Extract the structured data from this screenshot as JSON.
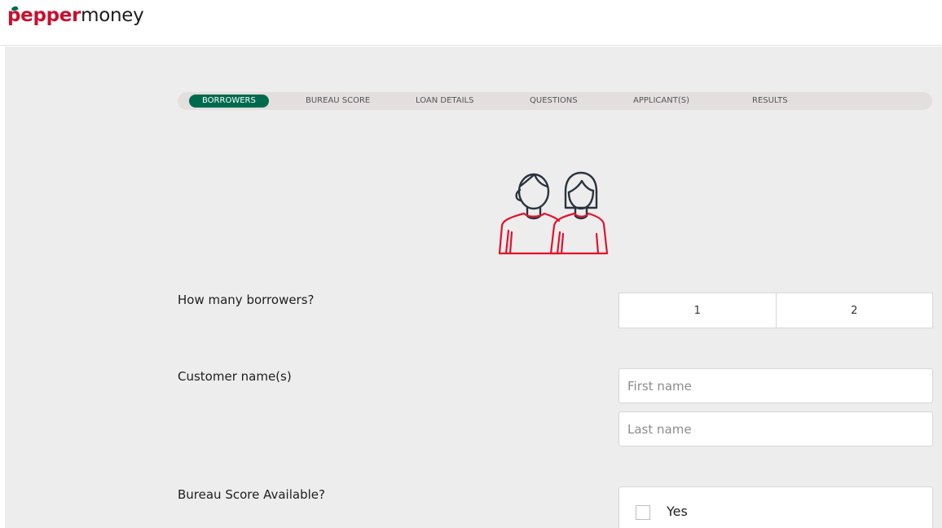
{
  "brand": {
    "pepper": "pepper",
    "money": "money",
    "accent_red": "#c8102e",
    "accent_green": "#006a4e"
  },
  "steps": [
    {
      "label": "BORROWERS",
      "active": true
    },
    {
      "label": "BUREAU SCORE",
      "active": false
    },
    {
      "label": "LOAN DETAILS",
      "active": false
    },
    {
      "label": "QUESTIONS",
      "active": false
    },
    {
      "label": "APPLICANT(S)",
      "active": false
    },
    {
      "label": "RESULTS",
      "active": false
    }
  ],
  "illustration_icon": "two-borrowers-icon",
  "borrowers": {
    "question": "How many borrowers?",
    "options": [
      "1",
      "2"
    ]
  },
  "customer": {
    "question": "Customer name(s)",
    "first_placeholder": "First name",
    "last_placeholder": "Last name"
  },
  "bureau": {
    "question": "Bureau Score Available?",
    "option_yes": "Yes"
  }
}
